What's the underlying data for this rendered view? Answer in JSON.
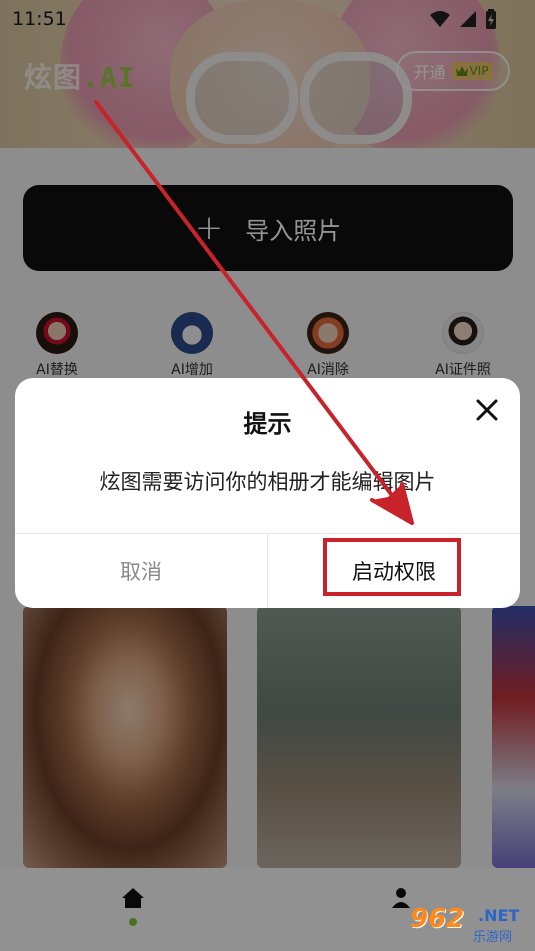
{
  "status_bar": {
    "time": "11:51"
  },
  "header": {
    "logo_text": "炫图",
    "logo_suffix": ".AI",
    "vip_button": {
      "label": "开通",
      "badge": "VIP"
    }
  },
  "import_button": {
    "icon": "plus-icon",
    "label": "导入照片"
  },
  "tools": [
    {
      "label": "AI替换"
    },
    {
      "label": "AI增加"
    },
    {
      "label": "AI消除"
    },
    {
      "label": "AI证件照"
    }
  ],
  "dialog": {
    "title": "提示",
    "message": "炫图需要访问你的相册才能编辑图片",
    "cancel_label": "取消",
    "confirm_label": "启动权限"
  },
  "bottom_nav": [
    {
      "icon": "home-icon",
      "active": true
    },
    {
      "icon": "profile-icon",
      "active": false
    }
  ],
  "watermark": {
    "number": "962",
    "suffix": ".NET",
    "text": "乐游网"
  },
  "colors": {
    "accent_green": "#7dc241",
    "highlight_red": "#c8232a",
    "import_button_bg": "#111111"
  }
}
